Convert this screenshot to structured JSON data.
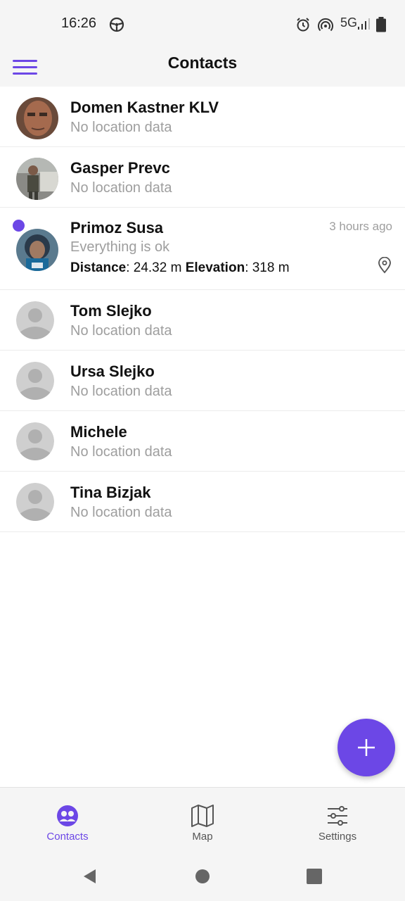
{
  "status_bar": {
    "time": "16:26",
    "network": "5G"
  },
  "app_bar": {
    "title": "Contacts",
    "menu_icon": "hamburger-menu-icon"
  },
  "contacts": [
    {
      "name": "Domen Kastner KLV",
      "status": "No location data",
      "avatar": "photo"
    },
    {
      "name": "Gasper Prevc",
      "status": "No location data",
      "avatar": "photo"
    },
    {
      "name": "Primoz Susa",
      "status": "Everything is ok",
      "time": "3 hours ago",
      "distance_label": "Distance",
      "distance_value": ": 24.32 m",
      "elevation_label": "Elevation",
      "elevation_value": ": 318 m",
      "avatar": "photo",
      "unread": true
    },
    {
      "name": "Tom Slejko",
      "status": "No location data",
      "avatar": "placeholder"
    },
    {
      "name": "Ursa Slejko",
      "status": "No location data",
      "avatar": "placeholder"
    },
    {
      "name": "Michele",
      "status": "No location data",
      "avatar": "placeholder"
    },
    {
      "name": "Tina Bizjak",
      "status": "No location data",
      "avatar": "placeholder"
    }
  ],
  "fab": {
    "icon": "plus-icon"
  },
  "bottom_nav": {
    "items": [
      {
        "label": "Contacts",
        "icon": "contacts-icon",
        "active": true
      },
      {
        "label": "Map",
        "icon": "map-icon",
        "active": false
      },
      {
        "label": "Settings",
        "icon": "settings-sliders-icon",
        "active": false
      }
    ]
  },
  "colors": {
    "accent": "#6C47E6",
    "secondary_text": "#9e9e9e",
    "bar_background": "#f5f5f5"
  }
}
